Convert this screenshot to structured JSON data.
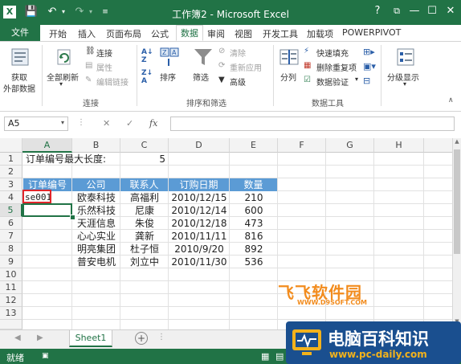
{
  "window": {
    "title": "工作簿2 - Microsoft Excel",
    "help": "?",
    "restore": "⧉",
    "minimize": "—",
    "maximize": "☐",
    "close": "✕"
  },
  "quick_access": {
    "save": "💾",
    "undo": "↶",
    "redo": "↷"
  },
  "tabs": {
    "file": "文件",
    "items": [
      "开始",
      "插入",
      "页面布局",
      "公式",
      "数据",
      "审阅",
      "视图",
      "开发工具",
      "加载项",
      "POWERPIVOT"
    ],
    "active": "数据"
  },
  "ribbon": {
    "get_external": "获取\n外部数据",
    "get_external_l1": "获取",
    "get_external_l2": "外部数据",
    "refresh_all": "全部刷新",
    "connections": "连接",
    "properties": "属性",
    "edit_links": "编辑链接",
    "group_connections": "连接",
    "sort": "排序",
    "filter": "筛选",
    "clear": "清除",
    "reapply": "重新应用",
    "advanced": "高级",
    "group_sort_filter": "排序和筛选",
    "text_to_columns": "分列",
    "flash_fill": "快速填充",
    "remove_duplicates": "删除重复项",
    "data_validation": "数据验证",
    "group_data_tools": "数据工具",
    "outline": "分级显示"
  },
  "formula_bar": {
    "name_box": "A5",
    "fx": "fx",
    "cancel": "✕",
    "enter": "✓",
    "value": ""
  },
  "columns": [
    "A",
    "B",
    "C",
    "D",
    "E",
    "F",
    "G",
    "H"
  ],
  "rows": [
    "1",
    "2",
    "3",
    "4",
    "5",
    "6",
    "7",
    "8",
    "9",
    "10",
    "11",
    "12",
    "13"
  ],
  "sheet": {
    "a1_label": "订单编号最大长度:",
    "c1_value": "5",
    "headers": [
      "订单编号",
      "公司",
      "联系人",
      "订购日期",
      "数量"
    ],
    "a4": "se001",
    "data": [
      [
        "欧泰科技",
        "高福利",
        "2010/12/15",
        "210"
      ],
      [
        "乐然科技",
        "尼康",
        "2010/12/14",
        "600"
      ],
      [
        "天涯信息",
        "朱俊",
        "2010/12/18",
        "473"
      ],
      [
        "心心实业",
        "龚新",
        "2010/11/11",
        "816"
      ],
      [
        "明亮集团",
        "杜子恒",
        "2010/9/20",
        "892"
      ],
      [
        "普安电机",
        "刘立中",
        "2010/11/30",
        "536"
      ]
    ]
  },
  "sheet_tabs": {
    "name": "Sheet1",
    "add": "+"
  },
  "status": {
    "ready": "就绪"
  },
  "watermarks": {
    "w1_line1": "飞飞软件园",
    "w1_line2": "WWW.D9SOFT.COM",
    "w2_line1": "电脑百科知识",
    "w2_line2": "www.pc-daily.com"
  },
  "colors": {
    "excel_green": "#217346",
    "header_blue": "#5b9bd5",
    "highlight_red": "#e0262c"
  }
}
